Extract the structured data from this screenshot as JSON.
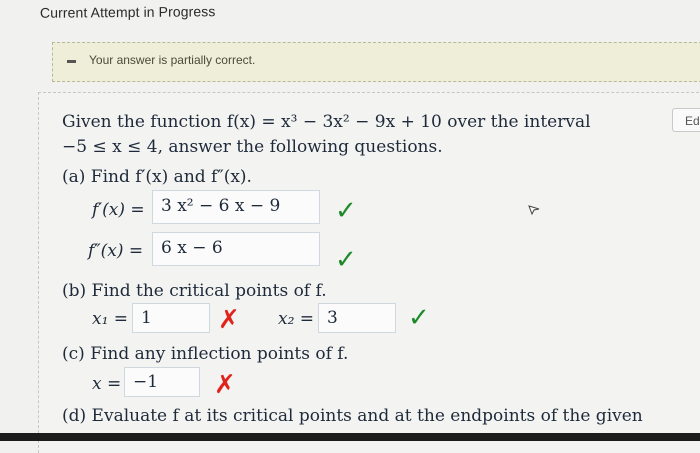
{
  "header": {
    "attempt_label": "Current Attempt in Progress"
  },
  "feedback": {
    "message": "Your answer is partially correct."
  },
  "toolbar": {
    "edit_label": "Edi"
  },
  "question": {
    "intro_line1": "Given the function f(x) = x³ − 3x² − 9x + 10 over the interval",
    "intro_line2": "−5 ≤ x ≤ 4, answer the following questions."
  },
  "part_a": {
    "prompt": "(a) Find f′(x) and f″(x).",
    "fprime_label": "f′(x) =",
    "fprime_value": "3 x² − 6 x − 9",
    "fprime_status": "✓",
    "fdouble_label": "f″(x) =",
    "fdouble_value": "6 x − 6",
    "fdouble_status": "✓"
  },
  "part_b": {
    "prompt": "(b) Find the critical points of f.",
    "x1_label": "x₁ =",
    "x1_value": "1",
    "x1_status": "✗",
    "x2_label": "x₂ =",
    "x2_value": "3",
    "x2_status": "✓"
  },
  "part_c": {
    "prompt": "(c) Find any inflection points of f.",
    "x_label": "x =",
    "x_value": "−1",
    "x_status": "✗"
  },
  "part_d": {
    "prompt": "(d) Evaluate f at its critical points and at the endpoints of the given"
  },
  "colors": {
    "correct": "#1d8a2a",
    "incorrect": "#e0231b",
    "feedback_bg": "#efeed9"
  }
}
